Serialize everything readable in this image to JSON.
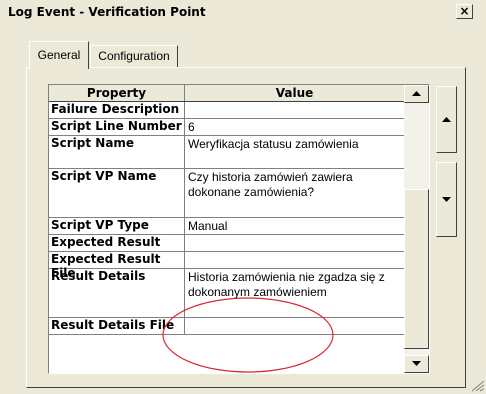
{
  "window": {
    "title": "Log Event - Verification Point",
    "close_glyph": "×"
  },
  "tabs": [
    {
      "label": "General",
      "active": true
    },
    {
      "label": "Configuration",
      "active": false
    }
  ],
  "table": {
    "headers": {
      "property": "Property",
      "value": "Value"
    },
    "rows": [
      {
        "property": "Failure Description",
        "value": ""
      },
      {
        "property": "Script Line Number",
        "value": "6"
      },
      {
        "property": "Script Name",
        "value": "Weryfikacja statusu zamówienia"
      },
      {
        "property": "Script VP Name",
        "value": "Czy historia zamówień zawiera dokonane zamówienia?"
      },
      {
        "property": "Script VP Type",
        "value": "Manual"
      },
      {
        "property": "Expected Result",
        "value": ""
      },
      {
        "property": "Expected Result File",
        "value": ""
      },
      {
        "property": "Result Details",
        "value": "Historia zamówienia nie zgadza się z dokonanym zamówieniem"
      },
      {
        "property": "Result Details File",
        "value": ""
      }
    ]
  },
  "scrollbar": {
    "up_icon": "triangle-up-icon",
    "down_icon": "triangle-down-icon"
  },
  "highlight": {
    "color": "#d9272e"
  }
}
